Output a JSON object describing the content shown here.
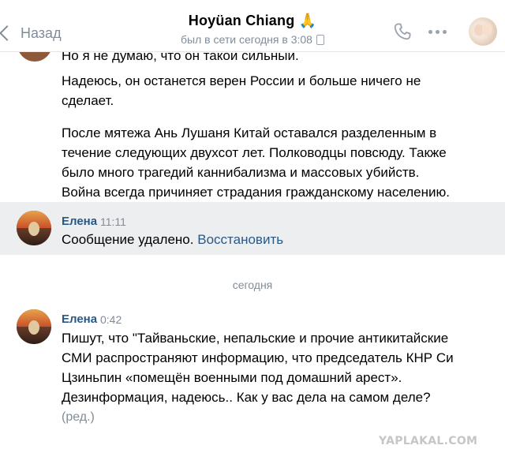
{
  "header": {
    "back_label": "Назад",
    "contact_name": "Hoyüan Chiang 🙏",
    "status": "был в сети сегодня в 3:08"
  },
  "messages": {
    "cut_line": "Но я не думаю, что он такой сильный.",
    "para1": [
      "Надеюсь, он останется верен России и больше ничего не",
      "сделает."
    ],
    "para2": [
      "После мятежа Ань Лушаня Китай оставался разделенным в",
      "течение следующих двухсот лет. Полководцы повсюду. Также",
      "было много трагедий каннибализма и массовых убийств.",
      "Война всегда причиняет страдания гражданскому населению."
    ],
    "deleted": {
      "author": "Елена",
      "time": "11:11",
      "text": "Сообщение удалено.",
      "restore": "Восстановить"
    },
    "date_separator": "сегодня",
    "last": {
      "author": "Елена",
      "time": "0:42",
      "lines": [
        "Пишут, что \"Тайваньские, непальские и прочие антикитайские",
        "СМИ распространяют информацию, что председатель КНР Си",
        "Цзиньпин «помещён военными под домашний арест».",
        "Дезинформация, надеюсь.. Как у вас дела на самом деле?"
      ],
      "edited": "(ред.)"
    }
  },
  "watermark": "YAPLAKAL.COM",
  "colors": {
    "link": "#2a5885",
    "muted": "#818c99",
    "deleted_bg": "#edeef0"
  }
}
